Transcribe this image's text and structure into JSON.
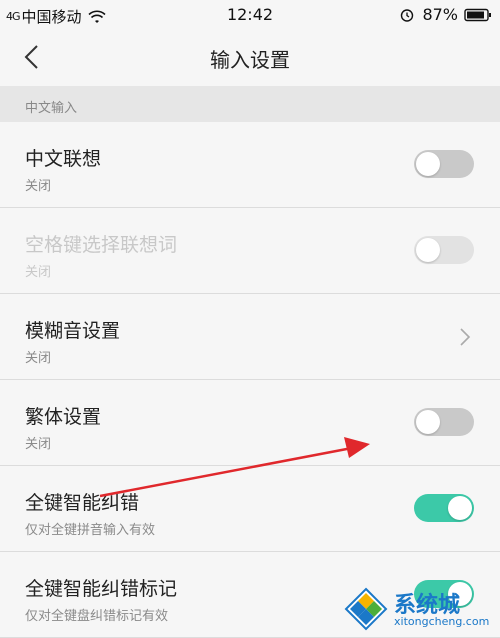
{
  "status_bar": {
    "signal_text": "4G",
    "carrier": "中国移动",
    "time": "12:42",
    "battery": "87%"
  },
  "nav": {
    "title": "输入设置"
  },
  "section": {
    "label": "中文输入"
  },
  "rows": [
    {
      "title": "中文联想",
      "subtitle": "关闭",
      "control": "toggle",
      "state": "off",
      "enabled": true
    },
    {
      "title": "空格键选择联想词",
      "subtitle": "关闭",
      "control": "toggle",
      "state": "off",
      "enabled": false
    },
    {
      "title": "模糊音设置",
      "subtitle": "关闭",
      "control": "chevron",
      "enabled": true
    },
    {
      "title": "繁体设置",
      "subtitle": "关闭",
      "control": "toggle",
      "state": "off",
      "enabled": true
    },
    {
      "title": "全键智能纠错",
      "subtitle": "仅对全键拼音输入有效",
      "control": "toggle",
      "state": "on",
      "enabled": true
    },
    {
      "title": "全键智能纠错标记",
      "subtitle": "仅对全键盘纠错标记有效",
      "control": "toggle",
      "state": "on",
      "enabled": true
    }
  ],
  "watermark": {
    "name": "系统城",
    "url": "xitongcheng.com"
  },
  "colors": {
    "toggle_on": "#3cc9a8",
    "toggle_off": "#c9c9c9",
    "annotation_arrow": "#e0282c",
    "watermark": "#1b78c8"
  }
}
